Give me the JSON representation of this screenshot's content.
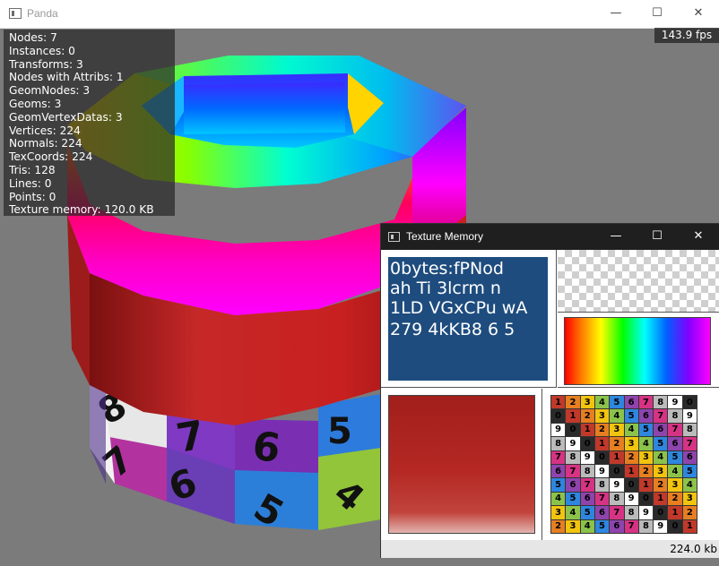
{
  "window": {
    "title": "Panda",
    "minimize": "—",
    "maximize": "☐",
    "close": "✕"
  },
  "fps": "143.9 fps",
  "stats": [
    "Nodes: 7",
    "Instances: 0",
    "Transforms: 3",
    "Nodes with Attribs: 1",
    "GeomNodes: 3",
    "Geoms: 3",
    "GeomVertexDatas: 3",
    "Vertices: 224",
    "Normals: 224",
    "TexCoords: 224",
    "Tris: 128",
    "Lines: 0",
    "Points: 0",
    "Texture memory: 120.0 KB"
  ],
  "texture_memory": {
    "title": "Texture Memory",
    "minimize": "—",
    "maximize": "☐",
    "close": "✕",
    "total": "224.0 kb",
    "font_texture_glyphs": [
      "0bytes:fPNod",
      "ah Ti 3lcrm n",
      "1LD VGxCPu wA",
      "279 4kKB8 6 5"
    ],
    "digit_grid": [
      [
        "1",
        "2",
        "3",
        "4",
        "5",
        "6",
        "7",
        "8",
        "9",
        "0"
      ],
      [
        "0",
        "1",
        "2",
        "3",
        "4",
        "5",
        "6",
        "7",
        "8",
        "9"
      ],
      [
        "9",
        "0",
        "1",
        "2",
        "3",
        "4",
        "5",
        "6",
        "7",
        "8"
      ],
      [
        "8",
        "9",
        "0",
        "1",
        "2",
        "3",
        "4",
        "5",
        "6",
        "7"
      ],
      [
        "7",
        "8",
        "9",
        "0",
        "1",
        "2",
        "3",
        "4",
        "5",
        "6"
      ],
      [
        "6",
        "7",
        "8",
        "9",
        "0",
        "1",
        "2",
        "3",
        "4",
        "5"
      ],
      [
        "5",
        "6",
        "7",
        "8",
        "9",
        "0",
        "1",
        "2",
        "3",
        "4"
      ],
      [
        "4",
        "5",
        "6",
        "7",
        "8",
        "9",
        "0",
        "1",
        "2",
        "3"
      ],
      [
        "3",
        "4",
        "5",
        "6",
        "7",
        "8",
        "9",
        "0",
        "1",
        "2"
      ],
      [
        "2",
        "3",
        "4",
        "5",
        "6",
        "7",
        "8",
        "9",
        "0",
        "1"
      ]
    ]
  },
  "colors": {
    "font_texture_bg": "#1e4c7e",
    "red_texture": "#a21f1c"
  }
}
